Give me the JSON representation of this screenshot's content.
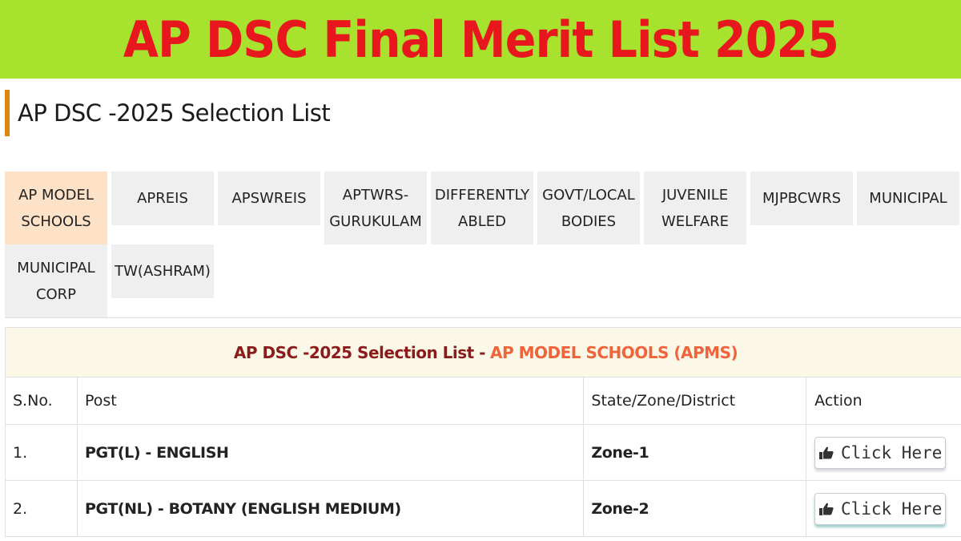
{
  "banner": {
    "title": "AP DSC Final Merit List 2025"
  },
  "section": {
    "title": "AP DSC -2025 Selection List"
  },
  "tabs": [
    {
      "label": "AP MODEL SCHOOLS",
      "active": true
    },
    {
      "label": "APREIS",
      "active": false
    },
    {
      "label": "APSWREIS",
      "active": false
    },
    {
      "label": "APTWRS-GURUKULAM",
      "active": false
    },
    {
      "label": "DIFFERENTLY ABLED",
      "active": false
    },
    {
      "label": "GOVT/LOCAL BODIES",
      "active": false
    },
    {
      "label": "JUVENILE WELFARE",
      "active": false
    },
    {
      "label": "MJPBCWRS",
      "active": false
    },
    {
      "label": "MUNICIPAL",
      "active": false
    },
    {
      "label": "MUNICIPAL CORP",
      "active": false
    },
    {
      "label": "TW(ASHRAM)",
      "active": false
    }
  ],
  "table": {
    "caption_main": "AP DSC -2025 Selection List -",
    "caption_sub": "AP MODEL SCHOOLS (APMS)",
    "headers": [
      "S.No.",
      "Post",
      "State/Zone/District",
      "Action"
    ],
    "rows": [
      {
        "sno": "1.",
        "post": "PGT(L) - ENGLISH",
        "zone": "Zone-1",
        "action": "Click Here"
      },
      {
        "sno": "2.",
        "post": "PGT(NL) - BOTANY (ENGLISH MEDIUM)",
        "zone": "Zone-2",
        "action": "Click Here"
      }
    ]
  },
  "colors": {
    "banner_bg": "#a6e22e",
    "banner_text": "#e8171e",
    "accent_bar": "#d98a0e",
    "active_tab": "#fde2c8",
    "caption_main": "#8c1c1c",
    "caption_sub": "#f0643c"
  },
  "icons": {
    "action_icon": "pointing-hand-icon"
  }
}
